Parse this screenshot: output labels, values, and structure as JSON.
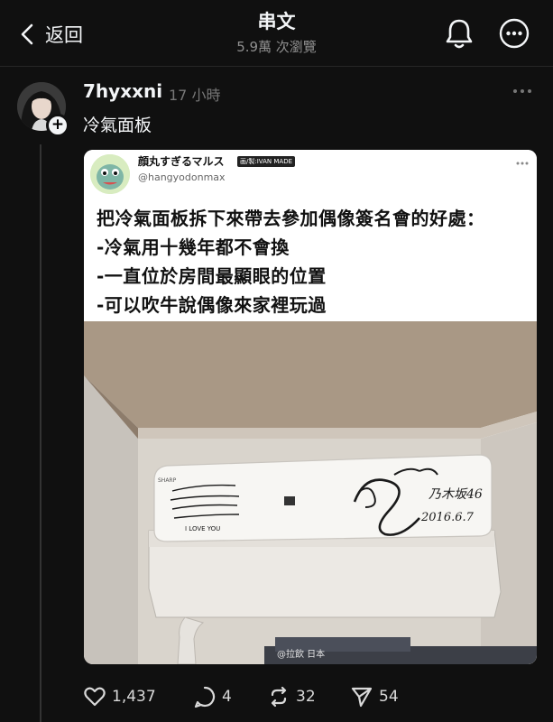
{
  "header": {
    "back_label": "返回",
    "title": "串文",
    "subtitle": "5.9萬 次瀏覽",
    "back_icon": "chevron-left-icon",
    "notify_icon": "bell-icon",
    "more_icon": "more-circle-icon"
  },
  "post": {
    "username": "7hyxxni",
    "time": "17 小時",
    "text": "冷氣面板",
    "follow_icon": "plus-icon"
  },
  "media": {
    "tweet_name": "顔丸すぎるマルス",
    "tweet_badge": "画/製:IVAN MADE",
    "tweet_handle": "@hangyodonmax",
    "tweet_lines": [
      "把冷氣面板拆下來帶去參加偶像簽名會的好處：",
      "-冷氣用十幾年都不會換",
      "-一直位於房間最顯眼的位置",
      "-可以吹牛說偶像來家裡玩過"
    ],
    "photo_date": "2016.6.7",
    "photo_group": "乃木坂46",
    "photo_note": "I LOVE YOU",
    "photo_watermark": "@拉飲 日本"
  },
  "actions": {
    "likes": "1,437",
    "replies": "4",
    "reposts": "32",
    "shares": "54"
  },
  "colors": {
    "background": "#101010",
    "text": "#f3f5f7",
    "muted": "#8f8f8f"
  }
}
